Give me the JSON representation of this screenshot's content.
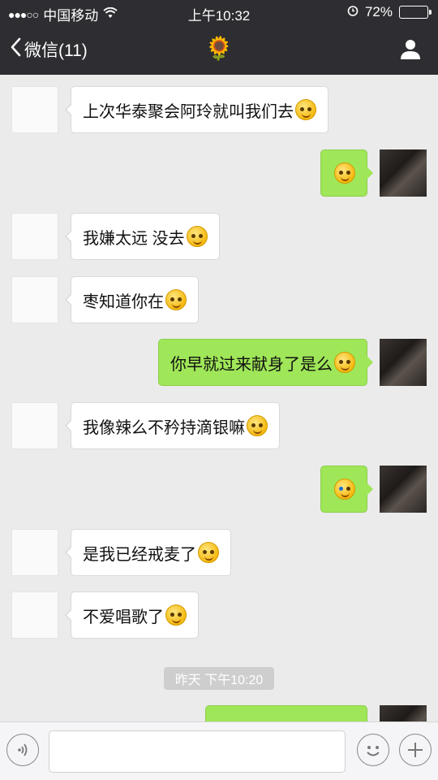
{
  "status_bar": {
    "signal_dots": "●●●○○",
    "carrier": "中国移动",
    "time": "上午10:32",
    "battery_percent": "72%",
    "battery_level": 0.72
  },
  "nav": {
    "back_label": "微信(11)",
    "title_icon": "sunflower",
    "title_glyph": "🌻",
    "profile_icon": "person-icon"
  },
  "messages": [
    {
      "from": "them",
      "text": "上次华泰聚会阿玲就叫我们去",
      "emoji": "blush"
    },
    {
      "from": "me",
      "text": "",
      "emoji": "blush"
    },
    {
      "from": "them",
      "text": "我嫌太远 没去",
      "emoji": "blush"
    },
    {
      "from": "them",
      "text": "枣知道你在",
      "emoji": "blush"
    },
    {
      "from": "me",
      "text": "你早就过来献身了是么",
      "emoji": "blush"
    },
    {
      "from": "them",
      "text": "我像辣么不矜持滴银嘛",
      "emoji": "blush"
    },
    {
      "from": "me",
      "text": "",
      "emoji": "cry-laugh"
    },
    {
      "from": "them",
      "text": "是我已经戒麦了",
      "emoji": "blush"
    },
    {
      "from": "them",
      "text": "不爱唱歌了",
      "emoji": "blush"
    }
  ],
  "time_separator": "昨天 下午10:20",
  "input_bar": {
    "voice_icon": "voice-icon",
    "emoji_icon": "emoji-icon",
    "plus_icon": "plus-icon",
    "text_value": ""
  },
  "colors": {
    "header_bg": "#2e2e32",
    "chat_bg": "#ebebeb",
    "my_bubble": "#9fe658",
    "their_bubble": "#ffffff"
  }
}
